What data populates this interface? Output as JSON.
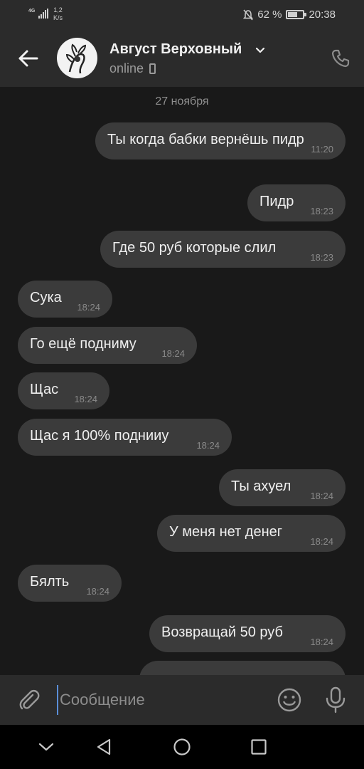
{
  "status_bar": {
    "network": "4G",
    "speed": "1,2\nK/s",
    "battery_text": "62 %",
    "battery_level": 0.62,
    "time": "20:38"
  },
  "header": {
    "name": "Август Верховный",
    "status": "online"
  },
  "chat": {
    "date": "27 ноября",
    "messages": [
      {
        "dir": "out",
        "text": "Ты когда бабки вернёшь пидр",
        "time": "11:20"
      },
      {
        "dir": "out",
        "text": "Пидр",
        "time": "18:23"
      },
      {
        "dir": "out",
        "text": "Где 50 руб которые слил",
        "time": "18:23"
      },
      {
        "dir": "in",
        "text": "Сука",
        "time": "18:24"
      },
      {
        "dir": "in",
        "text": "Го ещё подниму",
        "time": "18:24"
      },
      {
        "dir": "in",
        "text": "Щас",
        "time": "18:24"
      },
      {
        "dir": "in",
        "text": "Щас я 100% поднииу",
        "time": "18:24"
      },
      {
        "dir": "out",
        "text": "Ты ахуел",
        "time": "18:24"
      },
      {
        "dir": "out",
        "text": "У меня нет денег",
        "time": "18:24"
      },
      {
        "dir": "in",
        "text": "Бялть",
        "time": "18:24"
      },
      {
        "dir": "out",
        "text": "Возвращай 50 руб",
        "time": "18:24"
      }
    ]
  },
  "composer": {
    "placeholder": "Сообщение"
  },
  "icons": {
    "back": "arrow-left-icon",
    "call": "phone-icon",
    "attach": "paperclip-icon",
    "emoji": "smiley-icon",
    "mic": "microphone-icon"
  },
  "colors": {
    "bar_bg": "#2b2b2b",
    "chat_bg": "#191919",
    "bubble": "#3b3b3b",
    "cursor": "#5a8ed8"
  }
}
